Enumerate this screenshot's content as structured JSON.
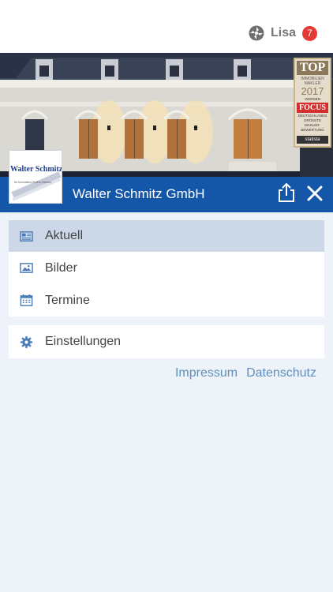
{
  "header": {
    "user_name": "Lisa",
    "notification_count": "7",
    "logo_icon": "puzzle-swirl-icon"
  },
  "hero": {
    "seal": {
      "top": "TOP",
      "sub": "IMMOBILIEN MAKLER",
      "year": "2017",
      "region": "VIERSEN",
      "magazine": "FOCUS",
      "note": "DEUTSCHLANDS GRÖSSTE MAKLER-BEWERTUNG",
      "partner": "statista"
    },
    "logo": {
      "name": "Walter Schmitz",
      "tagline": "Ihr Immobilien-Profi in Viersen"
    }
  },
  "title_bar": {
    "company": "Walter Schmitz GmbH",
    "share_icon": "share-icon",
    "close_icon": "close-icon"
  },
  "menu": {
    "items": [
      {
        "label": "Aktuell",
        "icon": "newspaper-icon",
        "active": true
      },
      {
        "label": "Bilder",
        "icon": "image-icon",
        "active": false
      },
      {
        "label": "Termine",
        "icon": "calendar-icon",
        "active": false
      }
    ],
    "settings": {
      "label": "Einstellungen",
      "icon": "gear-icon"
    }
  },
  "footer_links": {
    "impressum": "Impressum",
    "datenschutz": "Datenschutz"
  },
  "colors": {
    "primary": "#1457a8",
    "active_row": "#ccd8e8",
    "link": "#5f8fba",
    "badge": "#e53935",
    "icon": "#4a7bb7"
  }
}
